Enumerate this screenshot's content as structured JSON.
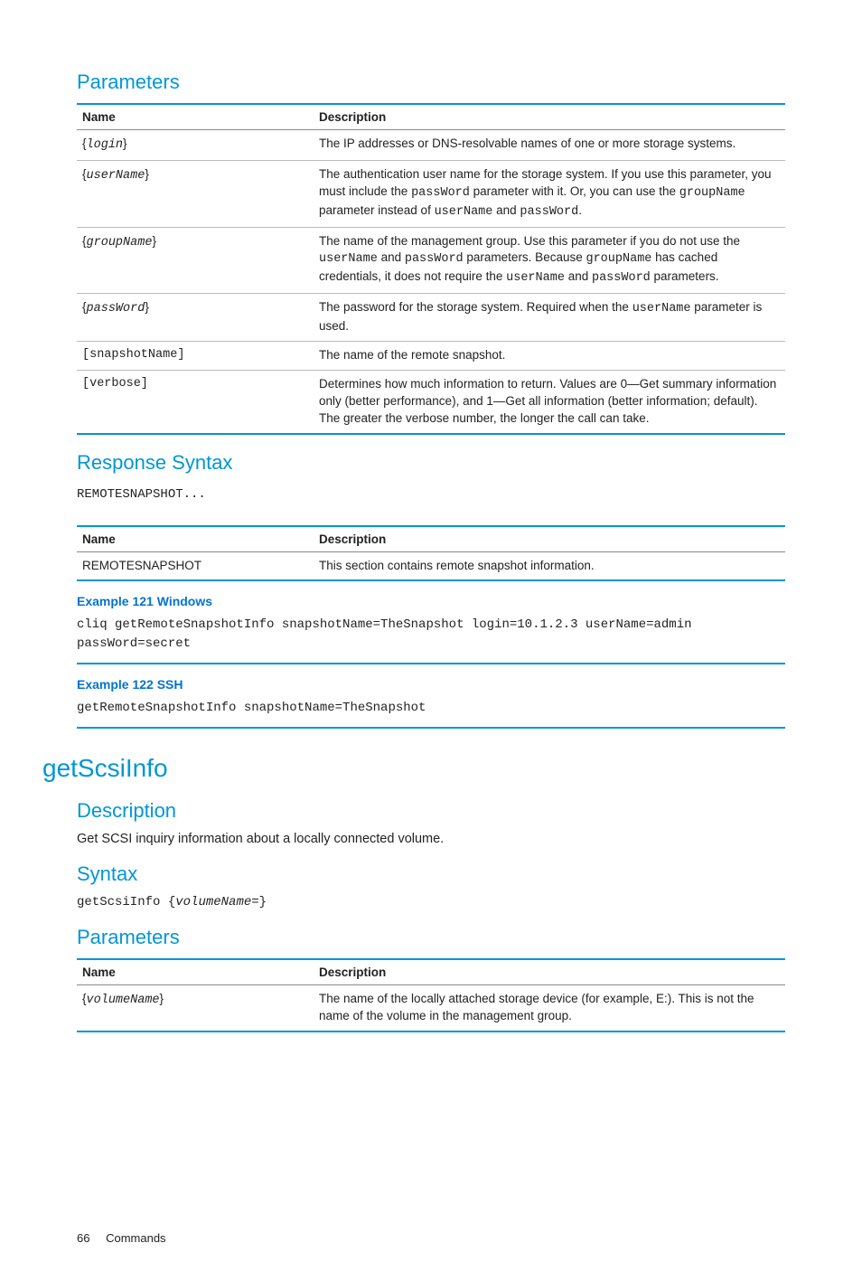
{
  "sections": {
    "parameters1_title": "Parameters",
    "params1_headers": {
      "name": "Name",
      "desc": "Description"
    },
    "params1": [
      {
        "name_open": "{",
        "name_param": "login",
        "name_close": "}",
        "desc_full": "The IP addresses or DNS-resolvable names of one or more storage systems."
      },
      {
        "name_open": "{",
        "name_param": "userName",
        "name_close": "}",
        "d1a": "The authentication user name for the storage system. If you use this parameter, you must include the ",
        "d1b": "passWord",
        "d1c": " parameter with it. Or, you can use the ",
        "d1d": "groupName",
        "d1e": " parameter instead of ",
        "d1f": "userName",
        "d1g": " and ",
        "d1h": "passWord",
        "d1i": "."
      },
      {
        "name_open": "{",
        "name_param": "groupName",
        "name_close": "}",
        "d2a": "The name of the management group. Use this parameter if you do not use the ",
        "d2b": "userName",
        "d2c": " and ",
        "d2d": "passWord",
        "d2e": " parameters. Because ",
        "d2f": "groupName",
        "d2g": " has cached credentials, it does not require the ",
        "d2h": "userName",
        "d2i": " and ",
        "d2j": "passWord",
        "d2k": " parameters."
      },
      {
        "name_open": "{",
        "name_param": "passWord",
        "name_close": "}",
        "d3a": "The password for the storage system. Required when the ",
        "d3b": "userName",
        "d3c": " parameter is used."
      },
      {
        "name_plain": "[snapshotName]",
        "desc_full": "The name of the remote snapshot."
      },
      {
        "name_plain": "[verbose]",
        "desc_full": "Determines how much information to return. Values are 0—Get summary information only (better performance), and 1—Get all information (better information; default). The greater the verbose number, the longer the call can take."
      }
    ],
    "response_title": "Response Syntax",
    "response_code": "REMOTESNAPSHOT...",
    "response_headers": {
      "name": "Name",
      "desc": "Description"
    },
    "response_rows": [
      {
        "name": "REMOTESNAPSHOT",
        "desc": "This section contains remote snapshot information."
      }
    ],
    "example1_title": "Example 121 Windows",
    "example1_code": "cliq getRemoteSnapshotInfo snapshotName=TheSnapshot login=10.1.2.3 userName=admin passWord=secret",
    "example2_title": "Example 122 SSH",
    "example2_code": "getRemoteSnapshotInfo snapshotName=TheSnapshot",
    "command_title": "getScsiInfo",
    "description_title": "Description",
    "description_text": "Get SCSI inquiry information about a locally connected volume.",
    "syntax_title": "Syntax",
    "syntax_cmd": "getScsiInfo",
    "syntax_open": " {",
    "syntax_param": "volumeName=",
    "syntax_close": "}",
    "parameters2_title": "Parameters",
    "params2_headers": {
      "name": "Name",
      "desc": "Description"
    },
    "params2": [
      {
        "name_open": "{",
        "name_param": "volumeName",
        "name_close": "}",
        "desc_full": "The name of the locally attached storage device (for example, E:). This is not the name of the volume in the management group."
      }
    ]
  },
  "footer": {
    "page": "66",
    "section": "Commands"
  }
}
